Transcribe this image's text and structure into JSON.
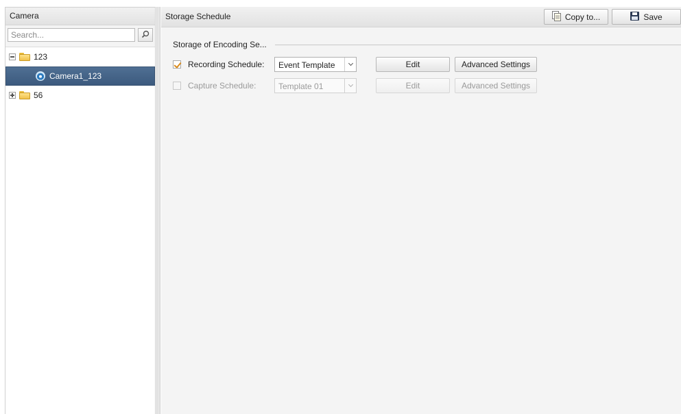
{
  "left_panel": {
    "title": "Camera",
    "search_placeholder": "Search...",
    "tree": [
      {
        "label": "123",
        "toggle": "minus"
      },
      {
        "label": "Camera1_123",
        "selected": true
      },
      {
        "label": "56",
        "toggle": "plus"
      }
    ]
  },
  "right_panel": {
    "title": "Storage Schedule",
    "copy_label": "Copy to...",
    "save_label": "Save",
    "group_title": "Storage of Encoding Se...",
    "rows": [
      {
        "label": "Recording Schedule:",
        "checked": true,
        "enabled": true,
        "template": "Event Template",
        "edit_label": "Edit",
        "advanced_label": "Advanced Settings"
      },
      {
        "label": "Capture Schedule:",
        "checked": false,
        "enabled": false,
        "template": "Template 01",
        "edit_label": "Edit",
        "advanced_label": "Advanced Settings"
      }
    ]
  },
  "colors": {
    "selected_row": "#4a6a8f",
    "checkmark": "#d98b1c",
    "panel_bg": "#f4f4f4"
  },
  "icons": {
    "search": "magnifier-icon",
    "copy": "copy-document-icon",
    "save": "floppy-disk-icon",
    "folder": "folder-icon",
    "camera": "camera-icon"
  }
}
